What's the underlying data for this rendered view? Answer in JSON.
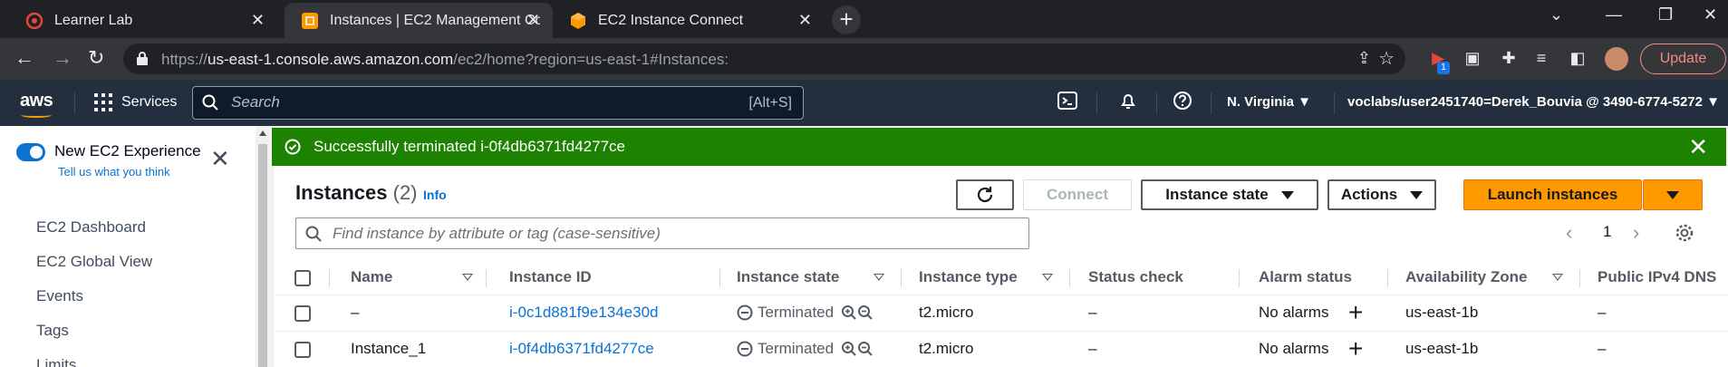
{
  "browser": {
    "tabs": [
      {
        "title": "Learner Lab",
        "favicon_color": "#e8453c"
      },
      {
        "title": "Instances | EC2 Management Cor",
        "favicon_color": "#ff9900"
      },
      {
        "title": "EC2 Instance Connect",
        "favicon_color": "#ff9900"
      }
    ],
    "url_prefix": "https://",
    "url_host": "us-east-1.console.aws.amazon.com",
    "url_path": "/ec2/home?region=us-east-1#Instances:",
    "update_label": "Update",
    "ext_badge": "1"
  },
  "aws_header": {
    "logo": "aws",
    "services": "Services",
    "search_placeholder": "Search",
    "search_shortcut": "[Alt+S]",
    "region": "N. Virginia",
    "account": "voclabs/user2451740=Derek_Bouvia @ 3490-6774-5272"
  },
  "sidebar": {
    "experience_label": "New EC2 Experience",
    "tell_us": "Tell us what you think",
    "items": [
      "EC2 Dashboard",
      "EC2 Global View",
      "Events",
      "Tags",
      "Limits"
    ]
  },
  "flash": {
    "message": "Successfully terminated i-0f4db6371fd4277ce",
    "color": "#1d8102"
  },
  "instances": {
    "title": "Instances",
    "count": "(2)",
    "info": "Info",
    "buttons": {
      "connect": "Connect",
      "instance_state": "Instance state",
      "actions": "Actions",
      "launch": "Launch instances"
    },
    "filter_placeholder": "Find instance by attribute or tag (case-sensitive)",
    "page": "1",
    "columns": [
      "Name",
      "Instance ID",
      "Instance state",
      "Instance type",
      "Status check",
      "Alarm status",
      "Availability Zone",
      "Public IPv4 DNS"
    ],
    "rows": [
      {
        "name": "–",
        "id": "i-0c1d881f9e134e30d",
        "state": "Terminated",
        "type": "t2.micro",
        "status": "–",
        "alarm": "No alarms",
        "az": "us-east-1b",
        "dns": "–"
      },
      {
        "name": "Instance_1",
        "id": "i-0f4db6371fd4277ce",
        "state": "Terminated",
        "type": "t2.micro",
        "status": "–",
        "alarm": "No alarms",
        "az": "us-east-1b",
        "dns": "–"
      }
    ]
  }
}
